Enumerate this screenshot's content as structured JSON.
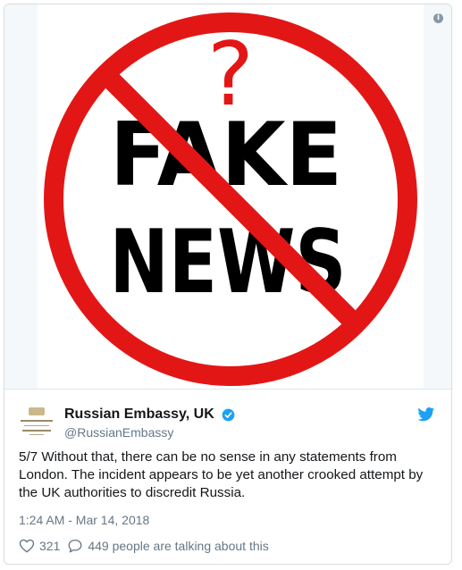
{
  "media": {
    "question_mark": "?",
    "line1": "FAKE",
    "line2": "NEWS",
    "circle_color": "#e31616",
    "text_color": "#000000"
  },
  "tweet": {
    "display_name": "Russian Embassy, UK",
    "handle": "@RussianEmbassy",
    "text": "5/7 Without that, there can be no sense in any statements from London. The incident appears to be yet another crooked attempt by the UK authorities to discredit Russia.",
    "timestamp": "1:24 AM - Mar 14, 2018",
    "likes": "321",
    "talking": "449 people are talking about this",
    "accent_color": "#1da1f2",
    "muted_color": "#657786"
  },
  "icons": {
    "info": "info-icon",
    "verified": "verified-badge-icon",
    "brand": "twitter-bird-icon",
    "like": "heart-icon",
    "reply": "speech-bubble-icon"
  }
}
